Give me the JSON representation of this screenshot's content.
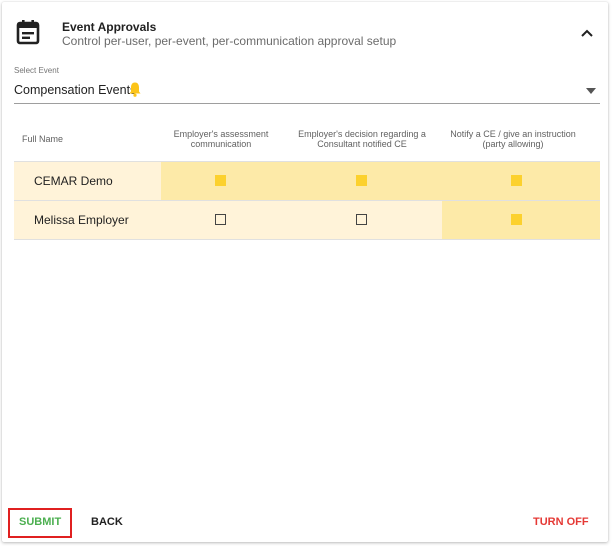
{
  "header": {
    "title": "Event Approvals",
    "subtitle": "Control per-user, per-event, per-communication approval setup"
  },
  "select_event": {
    "label": "Select Event",
    "value": "Compensation Events"
  },
  "table": {
    "columns": [
      "Full Name",
      "Employer's assessment communication",
      "Employer's decision regarding a Consultant notified CE",
      "Notify a CE / give an instruction (party allowing)"
    ],
    "rows": [
      {
        "name": "CEMAR Demo",
        "checks": [
          true,
          true,
          true
        ]
      },
      {
        "name": "Melissa Employer",
        "checks": [
          false,
          false,
          true
        ]
      }
    ]
  },
  "footer": {
    "submit": "SUBMIT",
    "back": "BACK",
    "turn_off": "TURN OFF"
  },
  "colors": {
    "checked_cell_bg": "#fdeaa8",
    "row_bg": "#fff3d9",
    "checkbox": "#fcd12e",
    "submit": "#4caf50",
    "turn_off": "#e53935",
    "highlight_border": "#e02020"
  }
}
